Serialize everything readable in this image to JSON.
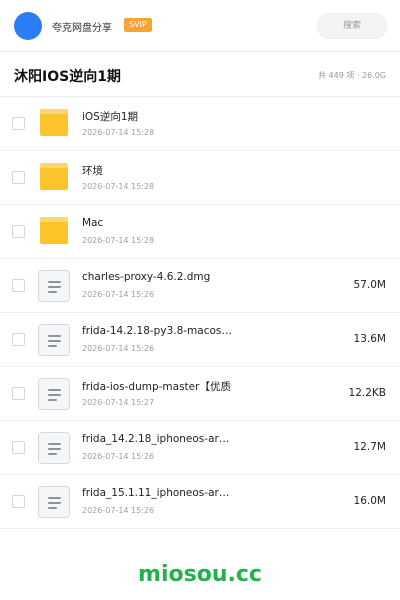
{
  "header": {
    "brand": "夸克网盘分享",
    "badge": "SVIP",
    "search_placeholder": "搜索",
    "accent_color": "#2c7cf6"
  },
  "title_bar": {
    "title": "沐阳IOS逆向1期",
    "stats": "共 449 项 · 26.0G"
  },
  "files": [
    {
      "type": "folder",
      "icon": "folder-icon",
      "name": "iOS逆向1期",
      "date": "2026-07-14 15:28",
      "size": ""
    },
    {
      "type": "folder",
      "icon": "folder-icon",
      "name": "环境",
      "date": "2026-07-14 15:28",
      "size": ""
    },
    {
      "type": "folder",
      "icon": "folder-icon",
      "name": "Mac",
      "date": "2026-07-14 15:28",
      "size": ""
    },
    {
      "type": "file",
      "icon": "document-icon",
      "name": "charles-proxy-4.6.2.dmg",
      "date": "2026-07-14 15:26",
      "size": "57.0M"
    },
    {
      "type": "file",
      "icon": "document-icon",
      "name": "frida-14.2.18-py3.8-macos…",
      "date": "2026-07-14 15:26",
      "size": "13.6M"
    },
    {
      "type": "file",
      "icon": "document-icon",
      "name": "frida-ios-dump-master【优质合…",
      "date": "2026-07-14 15:27",
      "size": "12.2KB"
    },
    {
      "type": "file",
      "icon": "document-icon",
      "name": "frida_14.2.18_iphoneos-ar…",
      "date": "2026-07-14 15:26",
      "size": "12.7M"
    },
    {
      "type": "file",
      "icon": "document-icon",
      "name": "frida_15.1.11_iphoneos-ar…",
      "date": "2026-07-14 15:26",
      "size": "16.0M"
    }
  ],
  "footer": {
    "watermark": "miosou.cc",
    "watermark_color": "#22b14c"
  }
}
